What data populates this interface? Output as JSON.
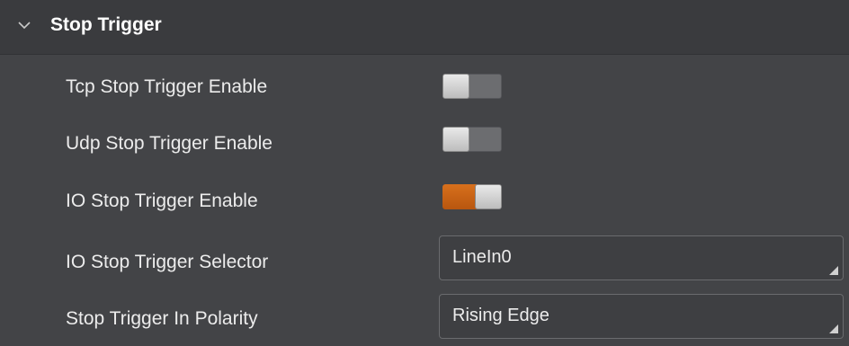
{
  "section": {
    "title": "Stop Trigger",
    "expanded_icon": "chevron-down-icon"
  },
  "params": {
    "tcp": {
      "label": "Tcp Stop Trigger Enable",
      "enabled": false
    },
    "udp": {
      "label": "Udp Stop Trigger Enable",
      "enabled": false
    },
    "io": {
      "label": "IO Stop Trigger Enable",
      "enabled": true
    },
    "selector": {
      "label": "IO Stop Trigger Selector",
      "value": "LineIn0"
    },
    "polarity": {
      "label": "Stop Trigger In Polarity",
      "value": "Rising Edge"
    }
  },
  "colors": {
    "panel_bg": "#434447",
    "toggle_on": "#d8701c",
    "toggle_off": "#6c6d70",
    "text": "#ececec"
  }
}
